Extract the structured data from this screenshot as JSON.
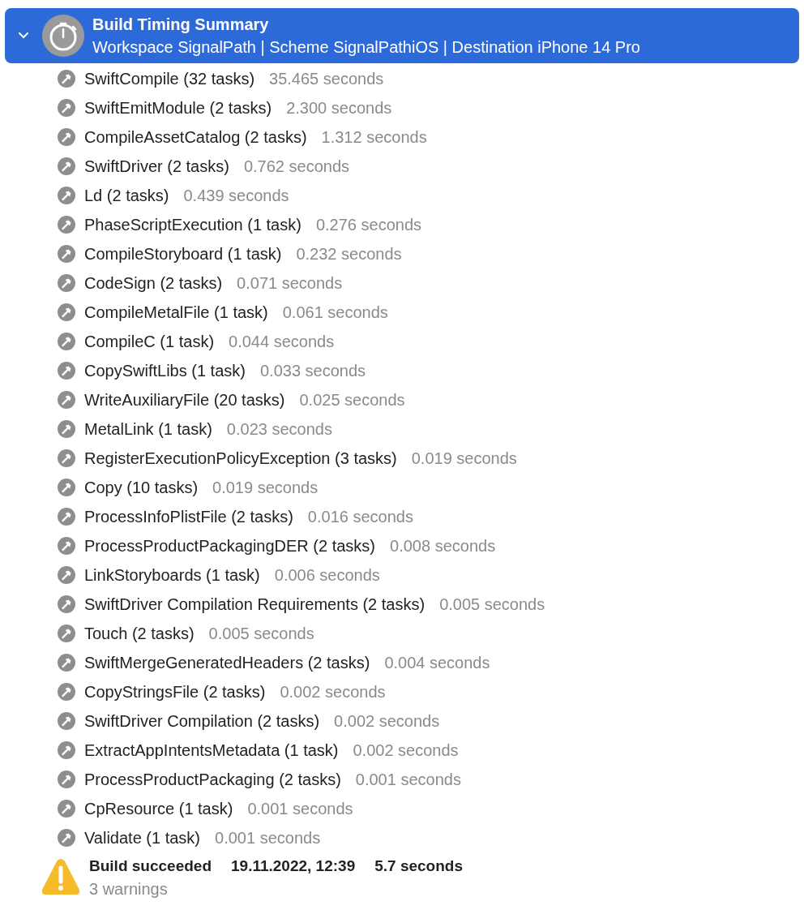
{
  "header": {
    "title": "Build Timing Summary",
    "subtitle": "Workspace SignalPath | Scheme SignalPathiOS | Destination iPhone 14 Pro",
    "expanded": true,
    "selected": true
  },
  "tasks": [
    {
      "name": "SwiftCompile (32 tasks)",
      "time": "35.465 seconds"
    },
    {
      "name": "SwiftEmitModule (2 tasks)",
      "time": "2.300 seconds"
    },
    {
      "name": "CompileAssetCatalog (2 tasks)",
      "time": "1.312 seconds"
    },
    {
      "name": "SwiftDriver (2 tasks)",
      "time": "0.762 seconds"
    },
    {
      "name": "Ld (2 tasks)",
      "time": "0.439 seconds"
    },
    {
      "name": "PhaseScriptExecution (1 task)",
      "time": "0.276 seconds"
    },
    {
      "name": "CompileStoryboard (1 task)",
      "time": "0.232 seconds"
    },
    {
      "name": "CodeSign (2 tasks)",
      "time": "0.071 seconds"
    },
    {
      "name": "CompileMetalFile (1 task)",
      "time": "0.061 seconds"
    },
    {
      "name": "CompileC (1 task)",
      "time": "0.044 seconds"
    },
    {
      "name": "CopySwiftLibs (1 task)",
      "time": "0.033 seconds"
    },
    {
      "name": "WriteAuxiliaryFile (20 tasks)",
      "time": "0.025 seconds"
    },
    {
      "name": "MetalLink (1 task)",
      "time": "0.023 seconds"
    },
    {
      "name": "RegisterExecutionPolicyException (3 tasks)",
      "time": "0.019 seconds"
    },
    {
      "name": "Copy (10 tasks)",
      "time": "0.019 seconds"
    },
    {
      "name": "ProcessInfoPlistFile (2 tasks)",
      "time": "0.016 seconds"
    },
    {
      "name": "ProcessProductPackagingDER (2 tasks)",
      "time": "0.008 seconds"
    },
    {
      "name": "LinkStoryboards (1 task)",
      "time": "0.006 seconds"
    },
    {
      "name": "SwiftDriver Compilation Requirements (2 tasks)",
      "time": "0.005 seconds"
    },
    {
      "name": "Touch (2 tasks)",
      "time": "0.005 seconds"
    },
    {
      "name": "SwiftMergeGeneratedHeaders (2 tasks)",
      "time": "0.004 seconds"
    },
    {
      "name": "CopyStringsFile (2 tasks)",
      "time": "0.002 seconds"
    },
    {
      "name": "SwiftDriver Compilation (2 tasks)",
      "time": "0.002 seconds"
    },
    {
      "name": "ExtractAppIntentsMetadata (1 task)",
      "time": "0.002 seconds"
    },
    {
      "name": "ProcessProductPackaging (2 tasks)",
      "time": "0.001 seconds"
    },
    {
      "name": "CpResource (1 task)",
      "time": "0.001 seconds"
    },
    {
      "name": "Validate (1 task)",
      "time": "0.001 seconds"
    }
  ],
  "result": {
    "status": "Build succeeded",
    "date": "19.11.2022, 12:39",
    "duration": "5.7 seconds",
    "warnings": "3 warnings"
  }
}
